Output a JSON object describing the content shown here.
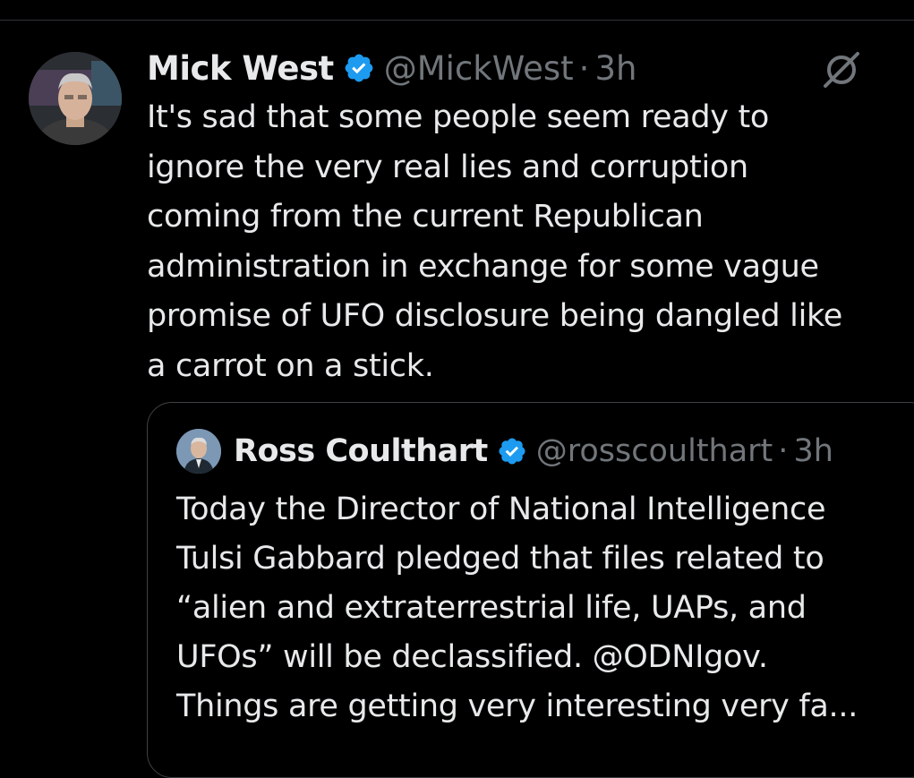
{
  "colors": {
    "background": "#000000",
    "text_primary": "#e7e9ea",
    "text_secondary": "#71767b",
    "verified_blue": "#1d9bf0",
    "border": "#3e4144"
  },
  "tweet": {
    "author_name": "Mick West",
    "handle": "@MickWest",
    "separator": "·",
    "time": "3h",
    "avatar_icon": "user-photo",
    "verified_icon": "verified-badge-icon",
    "grok_icon": "grok-icon",
    "text": "It's sad that some people seem ready to\nignore the very real lies and corruption\ncoming from the current Republican\nadministration in exchange for some vague\npromise of UFO disclosure being dangled like\na carrot on a stick."
  },
  "quoted_tweet": {
    "author_name": "Ross Coulthart",
    "handle": "@rosscoulthart",
    "separator": "·",
    "time": "3h",
    "avatar_icon": "user-photo",
    "verified_icon": "verified-badge-icon",
    "text": "Today the Director of National Intelligence\nTulsi Gabbard pledged that files related to\n“alien and extraterrestrial life, UAPs, and\nUFOs” will be declassified. @ODNIgov.\nThings are getting very interesting very fa..."
  }
}
